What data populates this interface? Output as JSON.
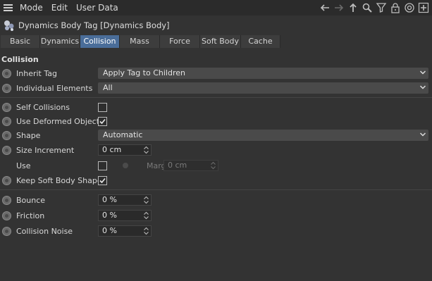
{
  "menubar": {
    "items": [
      "Mode",
      "Edit",
      "User Data"
    ]
  },
  "toolbar": {
    "icons": [
      "arrow-left-icon",
      "arrow-right-icon",
      "arrow-up-icon",
      "search-icon",
      "filter-icon",
      "lock-icon",
      "target-icon",
      "add-icon"
    ]
  },
  "header": {
    "title": "Dynamics Body Tag [Dynamics Body]"
  },
  "tabs": [
    {
      "label": "Basic"
    },
    {
      "label": "Dynamics"
    },
    {
      "label": "Collision",
      "active": true
    },
    {
      "label": "Mass"
    },
    {
      "label": "Force"
    },
    {
      "label": "Soft Body"
    },
    {
      "label": "Cache"
    }
  ],
  "section": {
    "title": "Collision"
  },
  "fields": {
    "inherit_tag": {
      "label": "Inherit Tag",
      "value": "Apply Tag to Children"
    },
    "individual_elements": {
      "label": "Individual Elements",
      "value": "All"
    },
    "self_collisions": {
      "label": "Self Collisions",
      "checked": false
    },
    "use_deformed_object": {
      "label": "Use Deformed Object",
      "checked": true
    },
    "shape": {
      "label": "Shape",
      "value": "Automatic"
    },
    "size_increment": {
      "label": "Size Increment",
      "value": "0 cm"
    },
    "use": {
      "label": "Use",
      "checked": false
    },
    "margin": {
      "label": "Margin",
      "value": "0 cm"
    },
    "keep_soft_body_shape": {
      "label": "Keep Soft Body Shape",
      "checked": true
    },
    "bounce": {
      "label": "Bounce",
      "value": "0 %"
    },
    "friction": {
      "label": "Friction",
      "value": "0 %"
    },
    "collision_noise": {
      "label": "Collision Noise",
      "value": "0 %"
    }
  },
  "colors": {
    "background": "#333333",
    "active_tab": "#4a6d99",
    "dropdown": "#4a4a4a"
  }
}
